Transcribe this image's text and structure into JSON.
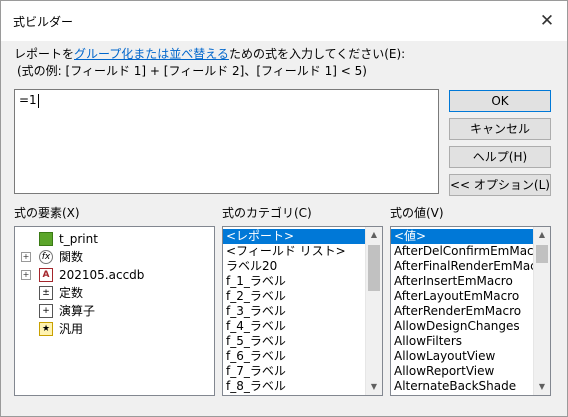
{
  "window": {
    "title": "式ビルダー",
    "close_glyph": "✕"
  },
  "instructions": {
    "pre": "レポートを",
    "link": "グループ化または並べ替える",
    "post": "ための式を入力してください(E):",
    "example": "(式の例: [フィールド 1] + [フィールド 2]、[フィールド 1] < 5)"
  },
  "editor": {
    "value": "=1"
  },
  "buttons": {
    "ok": "OK",
    "cancel": "キャンセル",
    "help": "ヘルプ(H)",
    "options": "<< オプション(L)"
  },
  "elements": {
    "label": "式の要素(X)",
    "items": [
      {
        "label": "t_print",
        "icon": "report-icon",
        "expandable": false
      },
      {
        "label": "関数",
        "icon": "function-icon",
        "expandable": true
      },
      {
        "label": "202105.accdb",
        "icon": "database-icon",
        "expandable": true
      },
      {
        "label": "定数",
        "icon": "constants-icon",
        "expandable": false
      },
      {
        "label": "演算子",
        "icon": "operators-icon",
        "expandable": false
      },
      {
        "label": "汎用",
        "icon": "common-expressions-icon",
        "expandable": false
      }
    ]
  },
  "categories": {
    "label": "式のカテゴリ(C)",
    "items": [
      "<レポート>",
      "<フィールド リスト>",
      "ラベル20",
      "f_1_ラベル",
      "f_2_ラベル",
      "f_3_ラベル",
      "f_4_ラベル",
      "f_5_ラベル",
      "f_6_ラベル",
      "f_7_ラベル",
      "f_8_ラベル"
    ],
    "selected_index": 0
  },
  "values": {
    "label": "式の値(V)",
    "items": [
      "<値>",
      "AfterDelConfirmEmMacro",
      "AfterFinalRenderEmMacro",
      "AfterInsertEmMacro",
      "AfterLayoutEmMacro",
      "AfterRenderEmMacro",
      "AllowDesignChanges",
      "AllowFilters",
      "AllowLayoutView",
      "AllowReportView",
      "AlternateBackShade"
    ],
    "selected_index": 0
  },
  "colors": {
    "selection": "#0078d7",
    "link": "#0066cc"
  }
}
